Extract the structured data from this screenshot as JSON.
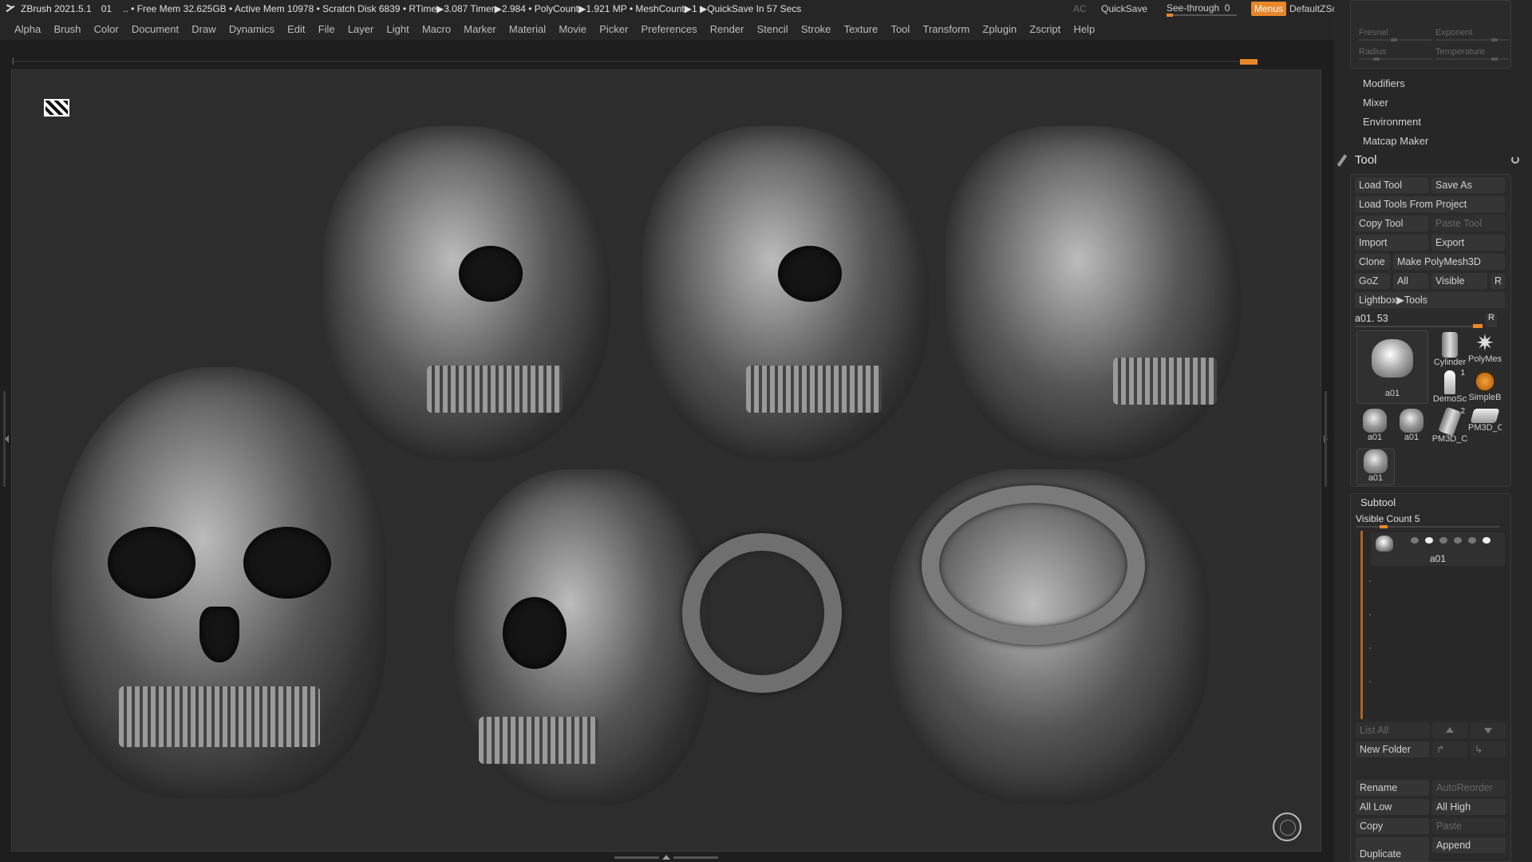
{
  "titlebar": {
    "app": "ZBrush 2021.5.1",
    "doc": "01",
    "stats": ".. • Free Mem 32.625GB • Active Mem 10978 • Scratch Disk 6839 •  RTime▶3.087 Timer▶2.984 • PolyCount▶1.921 MP  • MeshCount▶1  ▶QuickSave In 57 Secs",
    "ac": "AC",
    "quicksave": "QuickSave",
    "seethrough_label": "See-through",
    "seethrough_value": "0",
    "menus": "Menus",
    "script": "DefaultZScript"
  },
  "menubar": [
    "Alpha",
    "Brush",
    "Color",
    "Document",
    "Draw",
    "Dynamics",
    "Edit",
    "File",
    "Layer",
    "Light",
    "Macro",
    "Marker",
    "Material",
    "Movie",
    "Picker",
    "Preferences",
    "Render",
    "Stencil",
    "Stroke",
    "Texture",
    "Tool",
    "Transform",
    "Zplugin",
    "Zscript",
    "Help"
  ],
  "rpanel": {
    "top_sliders": {
      "fresnel": "Fresnel",
      "exponent": "Exponent",
      "radius": "Radius",
      "temperature": "Temperature"
    },
    "plain_items": [
      "Modifiers",
      "Mixer",
      "Environment",
      "Matcap Maker"
    ],
    "tool_title": "Tool",
    "buttons": {
      "load_tool": "Load Tool",
      "save_as": "Save As",
      "load_from_project": "Load Tools From Project",
      "copy_tool": "Copy Tool",
      "paste_tool": "Paste Tool",
      "import": "Import",
      "export": "Export",
      "clone": "Clone",
      "make_polymesh": "Make PolyMesh3D",
      "goz": "GoZ",
      "all": "All",
      "visible": "Visible",
      "r": "R",
      "lightbox_tools": "Lightbox▶Tools"
    },
    "tool_slider": {
      "label": "a01. 53",
      "r": "R"
    },
    "thumbs": {
      "main": "a01",
      "cylinder": "Cylinder",
      "polymesh": "PolyMes",
      "demo": "DemoSc",
      "demo_count": "1",
      "simple": "SimpleB",
      "a01_1": "a01",
      "a01_2": "a01",
      "pm3d_1": "PM3D_C",
      "pm3d_1_count": "2",
      "pm3d_2": "PM3D_C",
      "a01_3": "a01"
    },
    "subtool": {
      "title": "Subtool",
      "visible_count": "Visible Count 5",
      "item_label": "a01",
      "list_all": "List All",
      "new_folder": "New Folder",
      "rename": "Rename",
      "autoreorder": "AutoReorder",
      "all_low": "All Low",
      "all_high": "All High",
      "copy": "Copy",
      "paste": "Paste",
      "append": "Append",
      "duplicate": "Duplicate"
    }
  }
}
